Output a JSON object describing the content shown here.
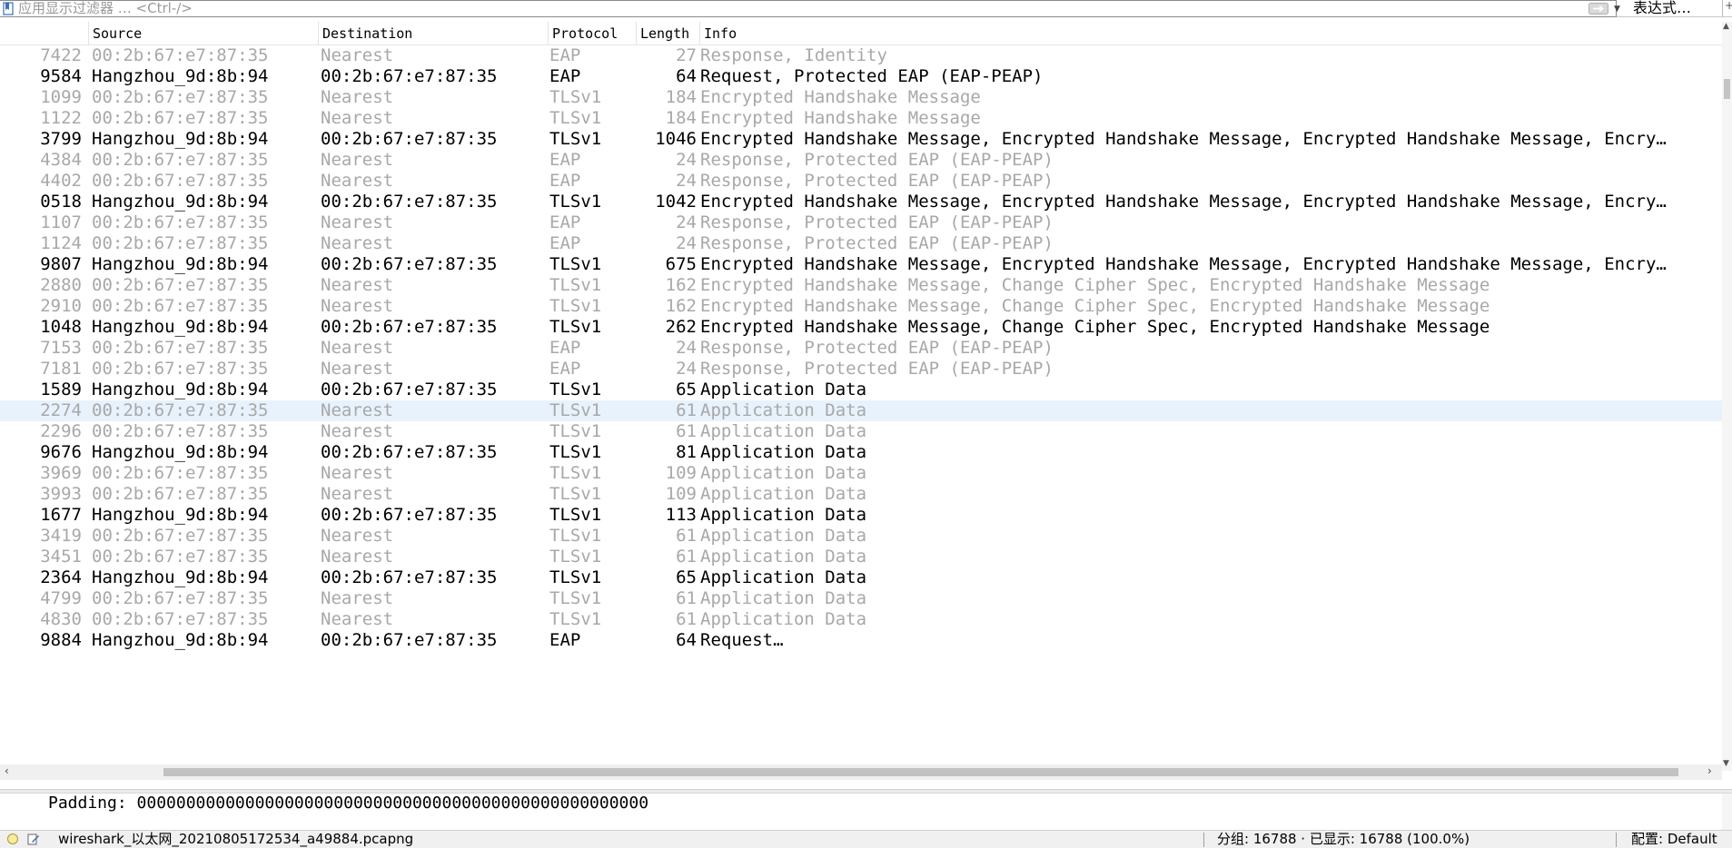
{
  "filter": {
    "placeholder": "应用显示过滤器 … <Ctrl-/>",
    "expression_label": "表达式…",
    "plus_label": "+"
  },
  "columns": {
    "time": "",
    "source": "Source",
    "destination": "Destination",
    "protocol": "Protocol",
    "length": "Length",
    "info": "Info"
  },
  "packets": [
    {
      "time": "7422",
      "source": "00:2b:67:e7:87:35",
      "destination": "Nearest",
      "protocol": "EAP",
      "length": "27",
      "info": "Response, Identity",
      "style": "dim"
    },
    {
      "time": "9584",
      "source": "Hangzhou_9d:8b:94",
      "destination": "00:2b:67:e7:87:35",
      "protocol": "EAP",
      "length": "64",
      "info": "Request, Protected EAP (EAP-PEAP)",
      "style": "bright"
    },
    {
      "time": "1099",
      "source": "00:2b:67:e7:87:35",
      "destination": "Nearest",
      "protocol": "TLSv1",
      "length": "184",
      "info": "Encrypted Handshake Message",
      "style": "dim"
    },
    {
      "time": "1122",
      "source": "00:2b:67:e7:87:35",
      "destination": "Nearest",
      "protocol": "TLSv1",
      "length": "184",
      "info": "Encrypted Handshake Message",
      "style": "dim"
    },
    {
      "time": "3799",
      "source": "Hangzhou_9d:8b:94",
      "destination": "00:2b:67:e7:87:35",
      "protocol": "TLSv1",
      "length": "1046",
      "info": "Encrypted Handshake Message, Encrypted Handshake Message, Encrypted Handshake Message, Encry…",
      "style": "bright"
    },
    {
      "time": "4384",
      "source": "00:2b:67:e7:87:35",
      "destination": "Nearest",
      "protocol": "EAP",
      "length": "24",
      "info": "Response, Protected EAP (EAP-PEAP)",
      "style": "dim"
    },
    {
      "time": "4402",
      "source": "00:2b:67:e7:87:35",
      "destination": "Nearest",
      "protocol": "EAP",
      "length": "24",
      "info": "Response, Protected EAP (EAP-PEAP)",
      "style": "dim"
    },
    {
      "time": "0518",
      "source": "Hangzhou_9d:8b:94",
      "destination": "00:2b:67:e7:87:35",
      "protocol": "TLSv1",
      "length": "1042",
      "info": "Encrypted Handshake Message, Encrypted Handshake Message, Encrypted Handshake Message, Encry…",
      "style": "bright"
    },
    {
      "time": "1107",
      "source": "00:2b:67:e7:87:35",
      "destination": "Nearest",
      "protocol": "EAP",
      "length": "24",
      "info": "Response, Protected EAP (EAP-PEAP)",
      "style": "dim"
    },
    {
      "time": "1124",
      "source": "00:2b:67:e7:87:35",
      "destination": "Nearest",
      "protocol": "EAP",
      "length": "24",
      "info": "Response, Protected EAP (EAP-PEAP)",
      "style": "dim"
    },
    {
      "time": "9807",
      "source": "Hangzhou_9d:8b:94",
      "destination": "00:2b:67:e7:87:35",
      "protocol": "TLSv1",
      "length": "675",
      "info": "Encrypted Handshake Message, Encrypted Handshake Message, Encrypted Handshake Message, Encry…",
      "style": "bright"
    },
    {
      "time": "2880",
      "source": "00:2b:67:e7:87:35",
      "destination": "Nearest",
      "protocol": "TLSv1",
      "length": "162",
      "info": "Encrypted Handshake Message, Change Cipher Spec, Encrypted Handshake Message",
      "style": "dim"
    },
    {
      "time": "2910",
      "source": "00:2b:67:e7:87:35",
      "destination": "Nearest",
      "protocol": "TLSv1",
      "length": "162",
      "info": "Encrypted Handshake Message, Change Cipher Spec, Encrypted Handshake Message",
      "style": "dim"
    },
    {
      "time": "1048",
      "source": "Hangzhou_9d:8b:94",
      "destination": "00:2b:67:e7:87:35",
      "protocol": "TLSv1",
      "length": "262",
      "info": "Encrypted Handshake Message, Change Cipher Spec, Encrypted Handshake Message",
      "style": "bright"
    },
    {
      "time": "7153",
      "source": "00:2b:67:e7:87:35",
      "destination": "Nearest",
      "protocol": "EAP",
      "length": "24",
      "info": "Response, Protected EAP (EAP-PEAP)",
      "style": "dim"
    },
    {
      "time": "7181",
      "source": "00:2b:67:e7:87:35",
      "destination": "Nearest",
      "protocol": "EAP",
      "length": "24",
      "info": "Response, Protected EAP (EAP-PEAP)",
      "style": "dim"
    },
    {
      "time": "1589",
      "source": "Hangzhou_9d:8b:94",
      "destination": "00:2b:67:e7:87:35",
      "protocol": "TLSv1",
      "length": "65",
      "info": "Application Data",
      "style": "bright"
    },
    {
      "time": "2274",
      "source": "00:2b:67:e7:87:35",
      "destination": "Nearest",
      "protocol": "TLSv1",
      "length": "61",
      "info": "Application Data",
      "style": "dim",
      "selected": true
    },
    {
      "time": "2296",
      "source": "00:2b:67:e7:87:35",
      "destination": "Nearest",
      "protocol": "TLSv1",
      "length": "61",
      "info": "Application Data",
      "style": "dim"
    },
    {
      "time": "9676",
      "source": "Hangzhou_9d:8b:94",
      "destination": "00:2b:67:e7:87:35",
      "protocol": "TLSv1",
      "length": "81",
      "info": "Application Data",
      "style": "bright"
    },
    {
      "time": "3969",
      "source": "00:2b:67:e7:87:35",
      "destination": "Nearest",
      "protocol": "TLSv1",
      "length": "109",
      "info": "Application Data",
      "style": "dim"
    },
    {
      "time": "3993",
      "source": "00:2b:67:e7:87:35",
      "destination": "Nearest",
      "protocol": "TLSv1",
      "length": "109",
      "info": "Application Data",
      "style": "dim"
    },
    {
      "time": "1677",
      "source": "Hangzhou_9d:8b:94",
      "destination": "00:2b:67:e7:87:35",
      "protocol": "TLSv1",
      "length": "113",
      "info": "Application Data",
      "style": "bright"
    },
    {
      "time": "3419",
      "source": "00:2b:67:e7:87:35",
      "destination": "Nearest",
      "protocol": "TLSv1",
      "length": "61",
      "info": "Application Data",
      "style": "dim"
    },
    {
      "time": "3451",
      "source": "00:2b:67:e7:87:35",
      "destination": "Nearest",
      "protocol": "TLSv1",
      "length": "61",
      "info": "Application Data",
      "style": "dim"
    },
    {
      "time": "2364",
      "source": "Hangzhou_9d:8b:94",
      "destination": "00:2b:67:e7:87:35",
      "protocol": "TLSv1",
      "length": "65",
      "info": "Application Data",
      "style": "bright"
    },
    {
      "time": "4799",
      "source": "00:2b:67:e7:87:35",
      "destination": "Nearest",
      "protocol": "TLSv1",
      "length": "61",
      "info": "Application Data",
      "style": "dim"
    },
    {
      "time": "4830",
      "source": "00:2b:67:e7:87:35",
      "destination": "Nearest",
      "protocol": "TLSv1",
      "length": "61",
      "info": "Application Data",
      "style": "dim"
    },
    {
      "time": "9884",
      "source": "Hangzhou_9d:8b:94",
      "destination": "00:2b:67:e7:87:35",
      "protocol": "EAP",
      "length": "64",
      "info": "Request…",
      "style": "bright"
    }
  ],
  "detail": {
    "line": "Padding: 0000000000000000000000000000000000000000000000000000"
  },
  "status": {
    "file": "wireshark_以太网_20210805172534_a49884.pcapng",
    "stats": "分组: 16788 · 已显示: 16788 (100.0%)",
    "profile": "配置: Default"
  },
  "colors": {
    "selected_row": "#e7f2fc",
    "dim_text": "#a8a8a8",
    "status_bg": "#f0f0f0"
  }
}
